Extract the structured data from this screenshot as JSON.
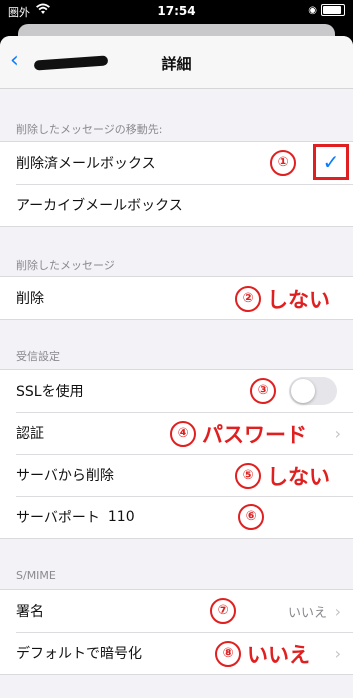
{
  "status_bar": {
    "carrier": "圏外",
    "time": "17:54"
  },
  "nav": {
    "title": "詳細"
  },
  "sections": {
    "move_to_header": "削除したメッセージの移動先:",
    "move_to_items": [
      "削除済メールボックス",
      "アーカイブメールボックス"
    ],
    "deleted_header": "削除したメッセージ",
    "deleted_row": "削除",
    "incoming_header": "受信設定",
    "ssl_label": "SSLを使用",
    "auth_label": "認証",
    "server_delete_label": "サーバから削除",
    "server_port_label": "サーバポート",
    "server_port_value": "110",
    "smime_header": "S/MIME",
    "sign_label": "署名",
    "sign_value": "いいえ",
    "encrypt_label": "デフォルトで暗号化"
  },
  "annotations": {
    "n1": "①",
    "n2": "②",
    "n3": "③",
    "n4": "④",
    "n5": "⑤",
    "n6": "⑥",
    "n7": "⑦",
    "n8": "⑧",
    "t2": "しない",
    "t4": "パスワード",
    "t5": "しない",
    "t8": "いいえ"
  },
  "colors": {
    "accent": "#0a7aff",
    "annotation": "#e02020"
  }
}
